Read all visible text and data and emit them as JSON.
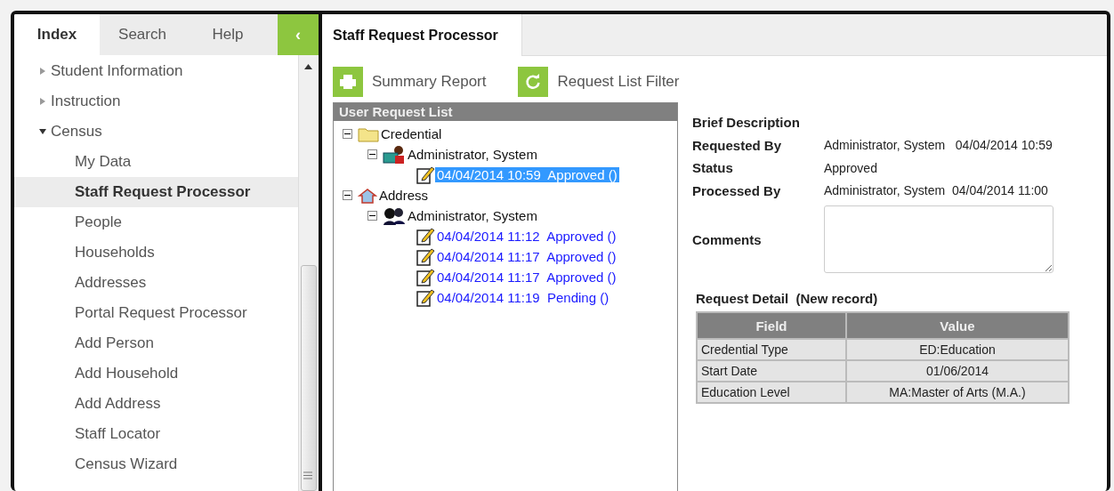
{
  "sidebar": {
    "tabs": [
      {
        "label": "Index",
        "selected": true
      },
      {
        "label": "Search",
        "selected": false
      },
      {
        "label": "Help",
        "selected": false
      }
    ],
    "collapse_button": "‹",
    "items": [
      {
        "label": "Student Information",
        "expanded": false
      },
      {
        "label": "Instruction",
        "expanded": false
      },
      {
        "label": "Census",
        "expanded": true,
        "children": [
          {
            "label": "My Data",
            "selected": false
          },
          {
            "label": "Staff Request Processor",
            "selected": true
          },
          {
            "label": "People",
            "selected": false
          },
          {
            "label": "Households",
            "selected": false
          },
          {
            "label": "Addresses",
            "selected": false
          },
          {
            "label": "Portal Request Processor",
            "selected": false
          },
          {
            "label": "Add Person",
            "selected": false
          },
          {
            "label": "Add Household",
            "selected": false
          },
          {
            "label": "Add Address",
            "selected": false
          },
          {
            "label": "Staff Locator",
            "selected": false
          },
          {
            "label": "Census Wizard",
            "selected": false
          }
        ]
      }
    ]
  },
  "page_tab": "Staff Request Processor",
  "toolbar": [
    {
      "label": "Summary Report",
      "kind": "print"
    },
    {
      "label": "Request List Filter",
      "kind": "refresh"
    }
  ],
  "request_list": {
    "title": "User Request List",
    "tree": [
      {
        "label": "Credential",
        "kind": "folder",
        "expanded": true,
        "children": [
          {
            "label": "Administrator, System",
            "kind": "person",
            "expanded": true,
            "children": [
              {
                "label": "04/04/2014 10:59  Approved ()",
                "kind": "request",
                "selected": true
              }
            ]
          }
        ]
      },
      {
        "label": "Address",
        "kind": "house",
        "expanded": true,
        "children": [
          {
            "label": "Administrator, System",
            "kind": "people",
            "expanded": true,
            "children": [
              {
                "label": "04/04/2014 11:12  Approved ()",
                "kind": "request",
                "selected": false
              },
              {
                "label": "04/04/2014 11:17  Approved ()",
                "kind": "request",
                "selected": false
              },
              {
                "label": "04/04/2014 11:17  Approved ()",
                "kind": "request",
                "selected": false
              },
              {
                "label": "04/04/2014 11:19  Pending ()",
                "kind": "request",
                "selected": false
              }
            ]
          }
        ]
      }
    ]
  },
  "details": {
    "brief_description": "Brief Description",
    "fields": [
      {
        "label": "Requested By",
        "value": "Administrator, System   04/04/2014 10:59"
      },
      {
        "label": "Status",
        "value": "Approved"
      },
      {
        "label": "Processed By",
        "value": "Administrator, System  04/04/2014 11:00"
      }
    ],
    "comments_label": "Comments",
    "request_detail": {
      "title": "Request Detail  (New record)",
      "columns": [
        "Field",
        "Value"
      ],
      "rows": [
        [
          "Credential Type",
          "ED:Education"
        ],
        [
          "Start Date",
          "01/06/2014"
        ],
        [
          "Education Level",
          "MA:Master of Arts (M.A.)"
        ]
      ]
    }
  }
}
